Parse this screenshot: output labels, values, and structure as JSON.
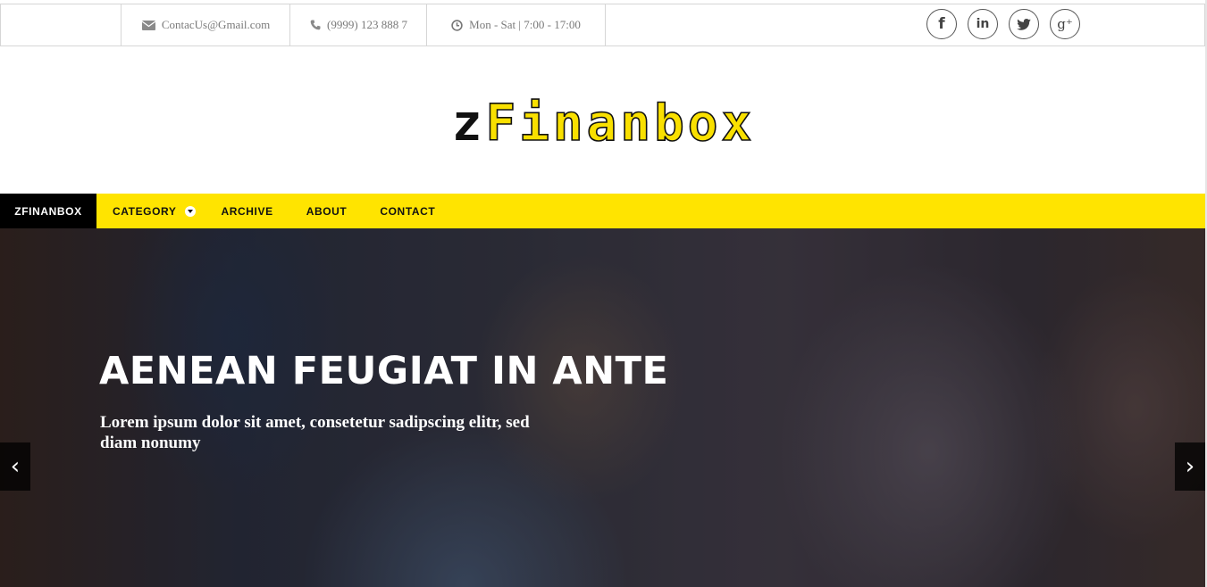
{
  "topbar": {
    "email": "ContacUs@Gmail.com",
    "phone": "(9999) 123 888 7",
    "hours": "Mon - Sat | 7:00 - 17:00",
    "icons": {
      "email": "envelope-icon",
      "phone": "phone-icon",
      "hours": "clock-icon"
    },
    "social": [
      {
        "name": "facebook-icon",
        "glyph": "f"
      },
      {
        "name": "linkedin-icon",
        "glyph": "in"
      },
      {
        "name": "twitter-icon",
        "glyph": ""
      },
      {
        "name": "google-plus-icon",
        "glyph": "g⁺"
      }
    ]
  },
  "logo": {
    "prefix": "z",
    "rest": "Finanbox"
  },
  "nav": {
    "home": "ZFINANBOX",
    "category": "CATEGORY",
    "archive": "ARCHIVE",
    "about": "ABOUT",
    "contact": "CONTACT"
  },
  "hero": {
    "title": "AENEAN FEUGIAT IN ANTE",
    "subtitle": "Lorem ipsum dolor sit amet, consetetur sadipscing elitr, sed diam nonumy",
    "prev": "‹",
    "next": "›"
  },
  "colors": {
    "accent": "#ffe400",
    "nav_home_bg": "#000000",
    "logo_fill": "#f9e000"
  }
}
